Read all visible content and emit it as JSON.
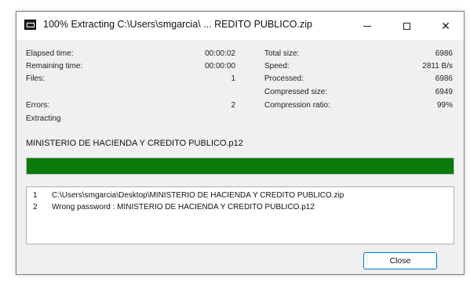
{
  "window": {
    "title": "100% Extracting C:\\Users\\smgarcia\\ ... REDITO PUBLICO.zip"
  },
  "stats_left": [
    {
      "label": "Elapsed time:",
      "value": "00:00:02"
    },
    {
      "label": "Remaining time:",
      "value": "00:00:00"
    },
    {
      "label": "Files:",
      "value": "1"
    },
    {
      "label": "",
      "value": ""
    },
    {
      "label": "Errors:",
      "value": "2"
    }
  ],
  "stats_right": [
    {
      "label": "Total size:",
      "value": "6986"
    },
    {
      "label": "Speed:",
      "value": "2811 B/s"
    },
    {
      "label": "Processed:",
      "value": "6986"
    },
    {
      "label": "Compressed size:",
      "value": "6949"
    },
    {
      "label": "Compression ratio:",
      "value": "99%"
    }
  ],
  "status_text": "Extracting",
  "current_file": "MINISTERIO DE HACIENDA Y CREDITO PUBLICO.p12",
  "progress_percent": 100,
  "progress_color": "#0a7a0a",
  "log": [
    {
      "num": "1",
      "text": "C:\\Users\\smgarcia\\Desktop\\MINISTERIO DE HACIENDA Y CREDITO PUBLICO.zip"
    },
    {
      "num": "2",
      "text": "Wrong password : MINISTERIO DE HACIENDA Y CREDITO PUBLICO.p12"
    }
  ],
  "close_button": "Close",
  "icons": {
    "app": "7zip-app-icon",
    "minimize": "minimize-icon",
    "maximize": "maximize-icon",
    "close": "close-icon"
  }
}
